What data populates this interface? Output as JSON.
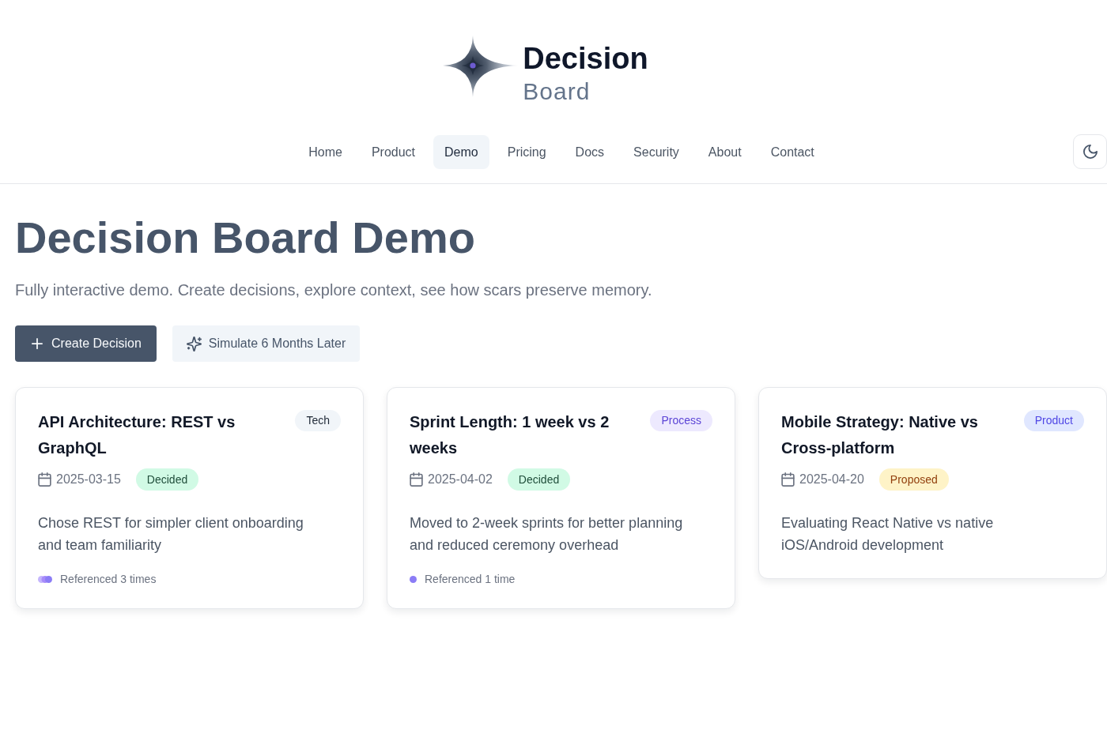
{
  "logo": {
    "title": "Decision",
    "subtitle": "Board"
  },
  "nav": {
    "items": [
      {
        "label": "Home",
        "selected": false
      },
      {
        "label": "Product",
        "selected": false
      },
      {
        "label": "Demo",
        "selected": true
      },
      {
        "label": "Pricing",
        "selected": false
      },
      {
        "label": "Docs",
        "selected": false
      },
      {
        "label": "Security",
        "selected": false
      },
      {
        "label": "About",
        "selected": false
      },
      {
        "label": "Contact",
        "selected": false
      }
    ]
  },
  "page": {
    "title": "Decision Board Demo",
    "subtitle": "Fully interactive demo. Create decisions, explore context, see how scars preserve memory."
  },
  "actions": [
    {
      "label": "Create Decision",
      "kind": "primary"
    },
    {
      "label": "Simulate 6 Months Later",
      "kind": "secondary"
    }
  ],
  "decisions": [
    {
      "title": "API Architecture: REST vs GraphQL",
      "tag": {
        "label": "Tech",
        "kind": "tech"
      },
      "date": "2025-03-15",
      "status": {
        "label": "Decided",
        "kind": "decided"
      },
      "summary": "Chose REST for simpler client onboarding and team familiarity",
      "references": {
        "label": "Referenced 3 times",
        "kind": "cluster"
      }
    },
    {
      "title": "Sprint Length: 1 week vs 2 weeks",
      "tag": {
        "label": "Process",
        "kind": "process"
      },
      "date": "2025-04-02",
      "status": {
        "label": "Decided",
        "kind": "decided"
      },
      "summary": "Moved to 2-week sprints for better planning and reduced ceremony overhead",
      "references": {
        "label": "Referenced 1 time",
        "kind": "dot"
      }
    },
    {
      "title": "Mobile Strategy: Native vs Cross-platform",
      "tag": {
        "label": "Product",
        "kind": "product"
      },
      "date": "2025-04-20",
      "status": {
        "label": "Proposed",
        "kind": "proposed"
      },
      "summary": "Evaluating React Native vs native iOS/Android development"
    }
  ]
}
